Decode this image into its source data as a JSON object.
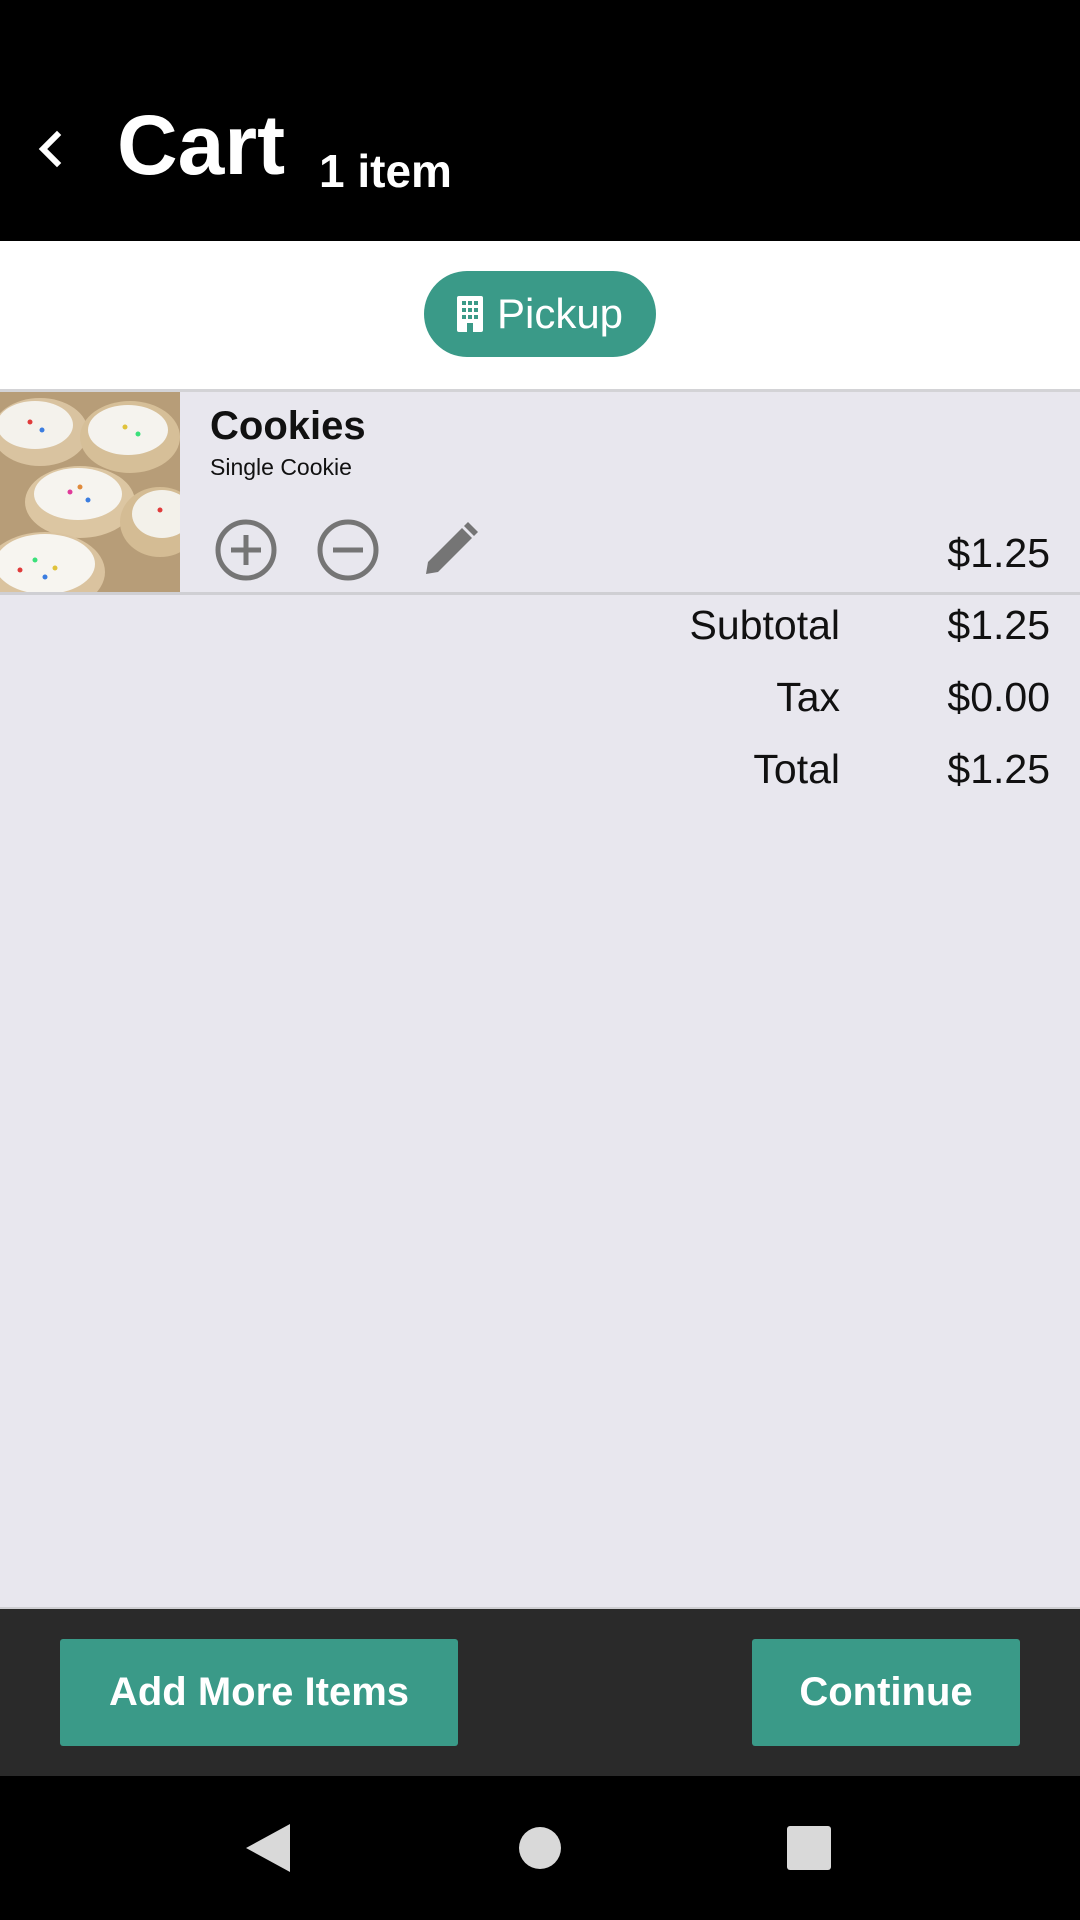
{
  "header": {
    "title": "Cart",
    "item_count": "1 item"
  },
  "order_mode": {
    "label": "Pickup",
    "icon": "building-icon"
  },
  "cart": {
    "items": [
      {
        "name": "Cookies",
        "option": "Single Cookie",
        "price": "$1.25"
      }
    ]
  },
  "totals": {
    "subtotal_label": "Subtotal",
    "subtotal": "$1.25",
    "tax_label": "Tax",
    "tax": "$0.00",
    "total_label": "Total",
    "total": "$1.25"
  },
  "actions": {
    "add_more": "Add More Items",
    "continue": "Continue"
  },
  "colors": {
    "accent": "#3a9a88",
    "header_bg": "#000000",
    "content_bg": "#e8e7ee"
  }
}
